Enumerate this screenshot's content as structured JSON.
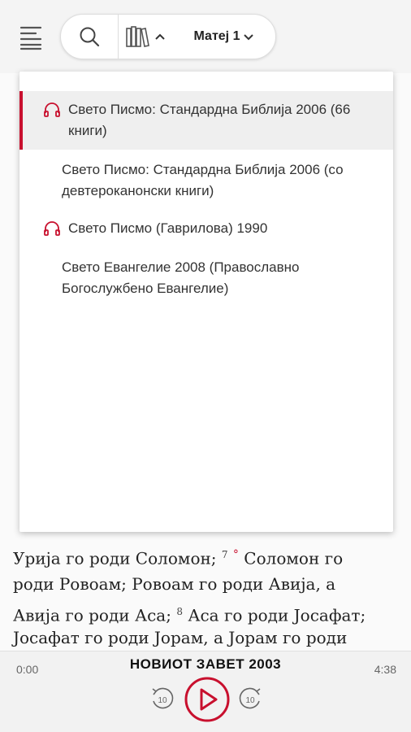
{
  "header": {
    "chapter_label": "Матеј 1",
    "icons": [
      "menu-icon",
      "search-icon",
      "books-icon",
      "chevron-up-icon",
      "chevron-down-icon"
    ]
  },
  "dropdown": {
    "items": [
      {
        "label": "Свето Писмо: Стандардна Библија 2006 (66 книги)",
        "audio": true,
        "selected": true
      },
      {
        "label": "Свето Писмо: Стандардна Библија 2006 (со девтероканонски книги)",
        "audio": false,
        "selected": false
      },
      {
        "label": "Свето Писмо (Гаврилова) 1990",
        "audio": true,
        "selected": false
      },
      {
        "label": "Свето Евангелие 2008 (Православно Богослужбено Евангелие)",
        "audio": false,
        "selected": false
      }
    ]
  },
  "reading": {
    "line1": "Урија го роди Соломон;",
    "verse7": "7",
    "line1b": "Соломон го",
    "line2": "роди Ровоам; Ровоам го роди Авија, а",
    "line3a": "Авија го роди Аса;",
    "verse8": "8",
    "line3b": "Аса го роди Јосафат;",
    "line4": "Јосафат го роди Јорам, а Јорам го роди"
  },
  "player": {
    "title": "НОВИОТ ЗАВЕТ 2003",
    "elapsed": "0:00",
    "duration": "4:38",
    "rewind_label": "10",
    "forward_label": "10"
  },
  "colors": {
    "accent": "#c8102e",
    "icon": "#555555"
  }
}
